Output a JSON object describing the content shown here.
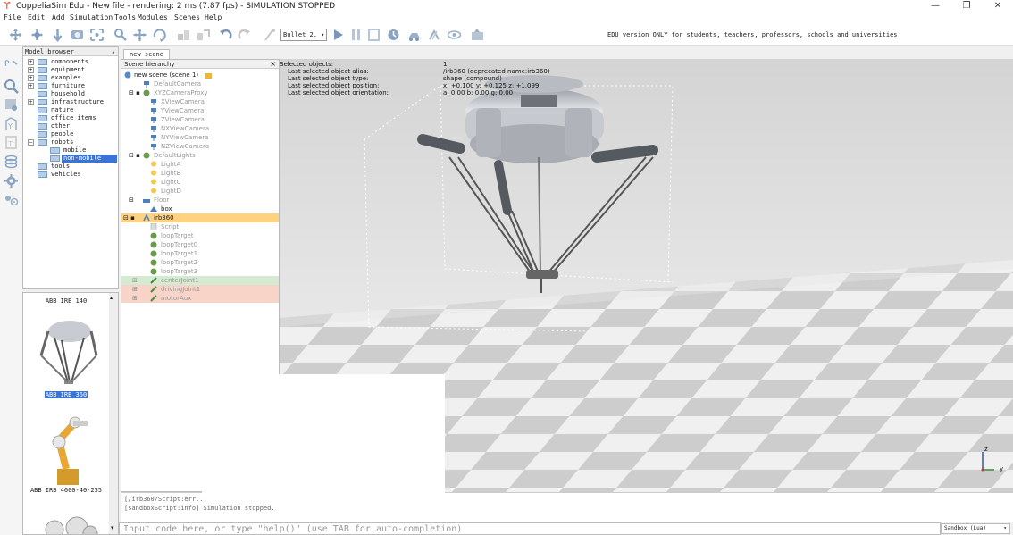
{
  "window": {
    "title": "CoppeliaSim Edu - New file - rendering: 2 ms (7.87 fps) - SIMULATION STOPPED",
    "minimize": "—",
    "maximize": "❐",
    "close": "✕"
  },
  "menu": [
    "File",
    "Edit",
    "Add",
    "Simulation",
    "Tools",
    "Modules",
    "Scenes",
    "Help"
  ],
  "toolbar": {
    "engine": "Bullet 2. ▾",
    "edu_notice": "EDU version ONLY for students, teachers, professors, schools and universities"
  },
  "model_browser": {
    "header": "Model browser",
    "items": [
      {
        "label": "components",
        "expander": "+"
      },
      {
        "label": "equipment",
        "expander": "+"
      },
      {
        "label": "examples",
        "expander": "+"
      },
      {
        "label": "furniture",
        "expander": "+"
      },
      {
        "label": "household",
        "expander": ""
      },
      {
        "label": "infrastructure",
        "expander": "+"
      },
      {
        "label": "nature",
        "expander": ""
      },
      {
        "label": "office items",
        "expander": ""
      },
      {
        "label": "other",
        "expander": ""
      },
      {
        "label": "people",
        "expander": ""
      },
      {
        "label": "robots",
        "expander": "−"
      },
      {
        "label": "mobile",
        "expander": ""
      },
      {
        "label": "non-mobile",
        "expander": ""
      },
      {
        "label": "tools",
        "expander": ""
      },
      {
        "label": "vehicles",
        "expander": ""
      }
    ]
  },
  "model_thumbs": [
    "ABB IRB 140",
    "ABB IRB 360",
    "ABB IRB 4600-40-255"
  ],
  "scene_tab": "new scene",
  "scene_hierarchy": {
    "header": "Scene hierarchy",
    "root": "new scene (scene 1)",
    "items": [
      "DefaultCamera",
      "XYZCameraProxy",
      "XViewCamera",
      "YViewCamera",
      "ZViewCamera",
      "NXViewCamera",
      "NYViewCamera",
      "NZViewCamera",
      "DefaultLights",
      "LightA",
      "LightB",
      "LightC",
      "LightD",
      "Floor",
      "box",
      "irb360",
      "Script",
      "loopTarget",
      "loopTarget0",
      "loopTarget1",
      "loopTarget2",
      "loopTarget3",
      "centerJoint1",
      "drivingJoint1",
      "motorAux"
    ]
  },
  "selection_info": {
    "labels": [
      "Selected objects:",
      "Last selected object alias:",
      "Last selected object type:",
      "Last selected object position:",
      "Last selected object orientation:"
    ],
    "values": [
      "1",
      "/irb360    (deprecated name:irb360)",
      "shape (compound)",
      "x: +0.100   y: +0.125   z: +1.099",
      "a: 0.00   b: 0.00   g: 0.00"
    ]
  },
  "axes": {
    "z": "z",
    "y": "y"
  },
  "console": {
    "lines": [
      "[/irb360/Script:err...",
      "[sandboxScript:info] Simulation stopped."
    ]
  },
  "input": {
    "placeholder": "Input code here, or type \"help()\" (use TAB for auto-completion)"
  },
  "sandbox": "Sandbox (Lua)",
  "colors": {
    "selected": "#3875d7",
    "robot_row": "#ffd27f",
    "joint_green": "#d5ebd1",
    "joint_red": "#f8d3c8",
    "floor_light": "#f0f0f0",
    "floor_dark": "#c8c8c8",
    "sky_top": "#d9d9d9"
  }
}
